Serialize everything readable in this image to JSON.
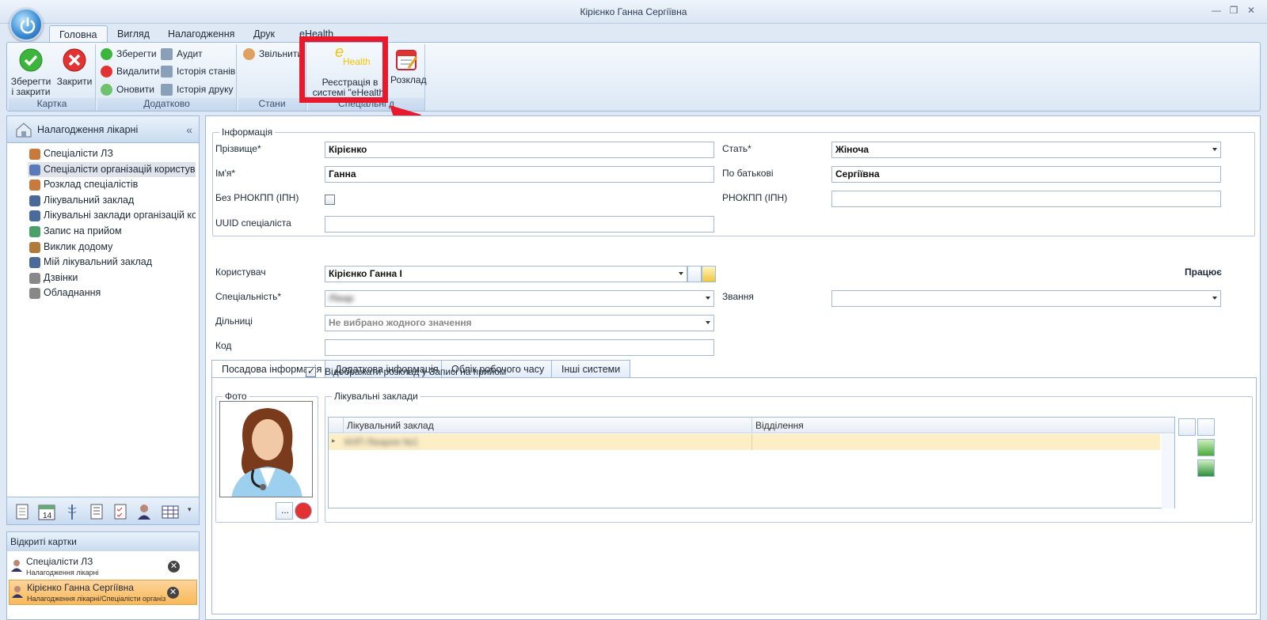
{
  "window": {
    "title": "Кірієнко Ганна Сергіївна"
  },
  "ribbon_tabs": [
    "Головна",
    "Вигляд",
    "Налагодження",
    "Друк",
    "eHealth"
  ],
  "ribbon": {
    "karta": {
      "label": "Картка",
      "save_close": "Зберегти і закрити",
      "close": "Закрити"
    },
    "dodatkovo": {
      "label": "Додатково",
      "save": "Зберегти",
      "delete": "Видалити",
      "refresh": "Оновити",
      "audit": "Аудит",
      "history_states": "Історія станів",
      "history_print": "Історія друку"
    },
    "stany": {
      "label": "Стани",
      "dismiss": "Звільнити"
    },
    "special": {
      "label": "Спеціальні д",
      "ehealth_register": "Реєстрація в системі \"eHealth\"",
      "schedule": "Розклад",
      "ehealth_logo": "Health"
    }
  },
  "left_nav": {
    "header": "Налагодження лікарні",
    "items": [
      "Спеціалісти ЛЗ",
      "Спеціалісти організацій користувач",
      "Розклад спеціалістів",
      "Лікувальний заклад",
      "Лікувальні заклади організацій кор",
      "Запис на прийом",
      "Виклик додому",
      "Мій лікувальний заклад",
      "Дзвінки",
      "Обладнання"
    ],
    "selected_index": 1
  },
  "open_cards": {
    "header": "Відкриті картки",
    "items": [
      {
        "title": "Спеціалісти ЛЗ",
        "subtitle": "Налагодження лікарні"
      },
      {
        "title": "Кірієнко Ганна Сергіївна",
        "subtitle": "Налагодження лікарні/Спеціалісти організ"
      }
    ]
  },
  "info": {
    "legend": "Інформація",
    "surname_label": "Прізвище*",
    "surname": "Кірієнко",
    "name_label": "Ім'я*",
    "name": "Ганна",
    "no_rnokpp_label": "Без РНОКПП (ІПН)",
    "uuid_label": "UUID спеціаліста",
    "uuid": "",
    "sex_label": "Стать*",
    "sex": "Жіноча",
    "patronymic_label": "По батькові",
    "patronymic": "Сергіївна",
    "rnokpp_label": "РНОКПП (ІПН)",
    "rnokpp": ""
  },
  "tabs": [
    "Посадова інформація",
    "Додаткова інформація",
    "Облік робочого часу",
    "Інші системи"
  ],
  "position": {
    "user_label": "Користувач",
    "user": "Кірієнко Ганна І",
    "status": "Працює",
    "specialty_label": "Спеціальність*",
    "specialty": "Лікар",
    "rank_label": "Звання",
    "rank": "",
    "districts_label": "Дільниці",
    "districts": "Не вибрано жодного значення",
    "code_label": "Код",
    "code": "",
    "show_schedule_label": "Відображати розклад у Записі на прийом"
  },
  "photo": {
    "legend": "Фото",
    "browse": "..."
  },
  "facilities": {
    "legend": "Лікувальні заклади",
    "columns": [
      "Лікувальний заклад",
      "Відділення"
    ],
    "rows": [
      {
        "facility": "КНП Лікарня №1",
        "department": ""
      }
    ]
  }
}
